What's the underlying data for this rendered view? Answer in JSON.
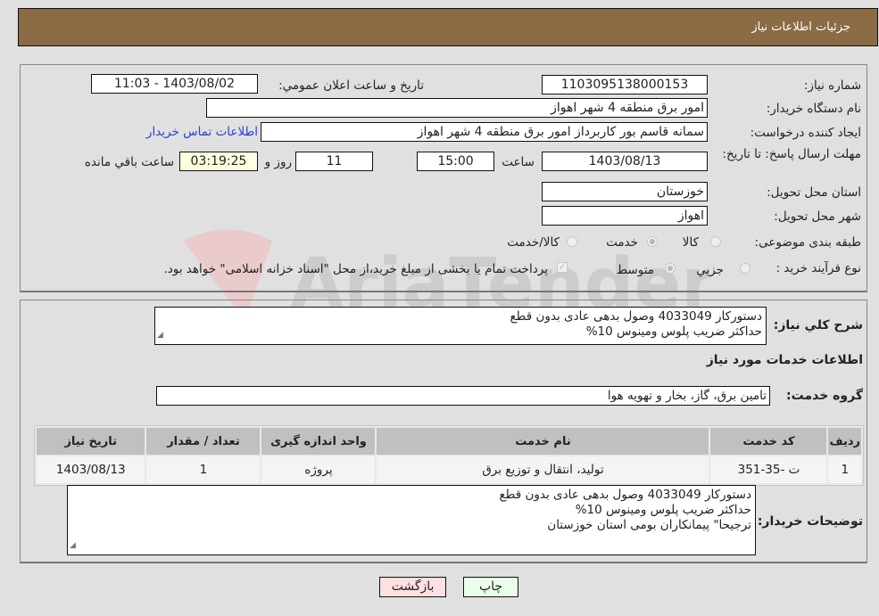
{
  "header": {
    "title": "جزئیات اطلاعات نیاز"
  },
  "form": {
    "need_number": {
      "label": "شماره نیاز:",
      "value": "1103095138000153"
    },
    "announce_datetime": {
      "label": "تاریخ و ساعت اعلان عمومي:",
      "value": "1403/08/02 - 11:03"
    },
    "buyer_org": {
      "label": "نام دستگاه خریدار:",
      "value": "امور برق منطقه 4 شهر اهواز"
    },
    "requester": {
      "label": "ایجاد کننده درخواست:",
      "value": "سمانه قاسم بور کاربرداز امور برق منطقه 4 شهر اهواز"
    },
    "buyer_contact_link": "اطلاعات تماس خریدار",
    "deadline": {
      "label": "مهلت ارسال پاسخ: تا تاریخ:",
      "date": "1403/08/13",
      "time_label": "ساعت",
      "time": "15:00",
      "days": "11",
      "days_label": "روز و",
      "remaining": "03:19:25",
      "remaining_label": "ساعت باقي مانده"
    },
    "province": {
      "label": "استان محل تحویل:",
      "value": "خوزستان"
    },
    "city": {
      "label": "شهر محل تحویل:",
      "value": "اهواز"
    },
    "category": {
      "label": "طبقه بندی موضوعی:",
      "options": [
        {
          "label": "کالا",
          "selected": false
        },
        {
          "label": "خدمت",
          "selected": true
        },
        {
          "label": "کالا/خدمت",
          "selected": false
        }
      ]
    },
    "purchase_type": {
      "label": "نوع فرآیند خرید :",
      "options": [
        {
          "label": "جزيي",
          "selected": false
        },
        {
          "label": "متوسط",
          "selected": true
        }
      ],
      "treasury_check": {
        "checked": true,
        "label": "پرداخت تمام یا بخشی از مبلغ خرید،از محل \"اسناد خزانه اسلامی\" خواهد بود."
      }
    }
  },
  "description": {
    "label": "شرح کلي نياز:",
    "lines": [
      "دستورکار 4033049 وصول بدهی عادی بدون قطع",
      "حداکثر ضریب پلوس ومینوس 10%"
    ]
  },
  "services_section_title": "اطلاعات خدمات مورد نياز",
  "service_group": {
    "label": "گروه خدمت:",
    "value": "تامین برق، گاز، بخار و تهویه هوا"
  },
  "table": {
    "headers": [
      "ردیف",
      "کد خدمت",
      "نام خدمت",
      "واحد اندازه گیری",
      "تعداد / مقدار",
      "تاریخ نیاز"
    ],
    "rows": [
      [
        "1",
        "ت -35-351",
        "تولید، انتقال و توزیع برق",
        "پروژه",
        "1",
        "1403/08/13"
      ]
    ]
  },
  "buyer_notes": {
    "label": "توضیحات خریدار:",
    "lines": [
      "دستورکار 4033049 وصول بدهی عادی بدون قطع",
      "حداکثر ضریب پلوس ومینوس 10%",
      "ترجیحا\" پیمانکاران بومی استان خوزستان"
    ]
  },
  "buttons": {
    "print": "چاپ",
    "back": "بازگشت"
  },
  "watermark": "AriaTender.neT",
  "colors": {
    "header_bg": "#8b6b43",
    "link": "#2a3fcf",
    "print_bg": "#eaffea",
    "back_bg": "#ffe0e0"
  }
}
